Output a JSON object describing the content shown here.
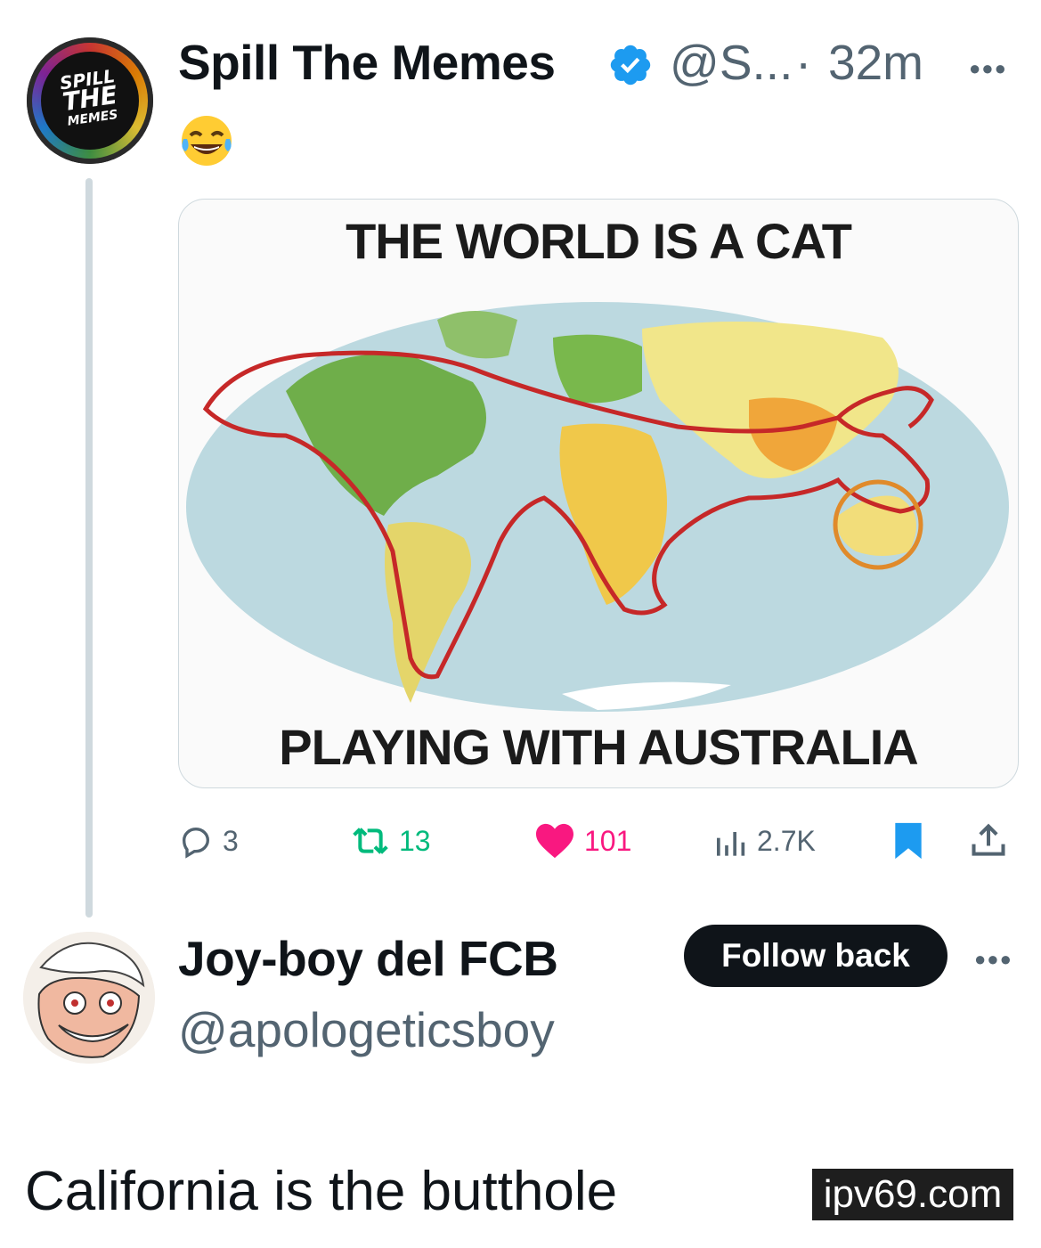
{
  "post": {
    "author_name": "Spill The Memes",
    "author_handle": "@S...",
    "separator": "·",
    "time": "32m",
    "verified": true,
    "avatar_text": [
      "SPILL",
      "THE",
      "MEMES"
    ],
    "body_emoji": "😂",
    "more_icon": "more-dots-icon"
  },
  "media": {
    "top_caption": "THE WORLD IS A CAT",
    "bottom_caption": "PLAYING WITH AUSTRALIA"
  },
  "actions": {
    "replies": "3",
    "reposts": "13",
    "likes": "101",
    "views": "2.7K"
  },
  "reply": {
    "author_name": "Joy-boy del FCB",
    "author_handle": "@apologeticsboy",
    "follow_label": "Follow back",
    "text": "California is the butthole"
  },
  "watermark": "ipv69.com",
  "colors": {
    "text": "#0f1419",
    "secondary": "#536471",
    "verified": "#1d9bf0",
    "repost": "#00ba7c",
    "like": "#f91880",
    "bookmark": "#1d9bf0",
    "cat_outline": "#c62828"
  }
}
